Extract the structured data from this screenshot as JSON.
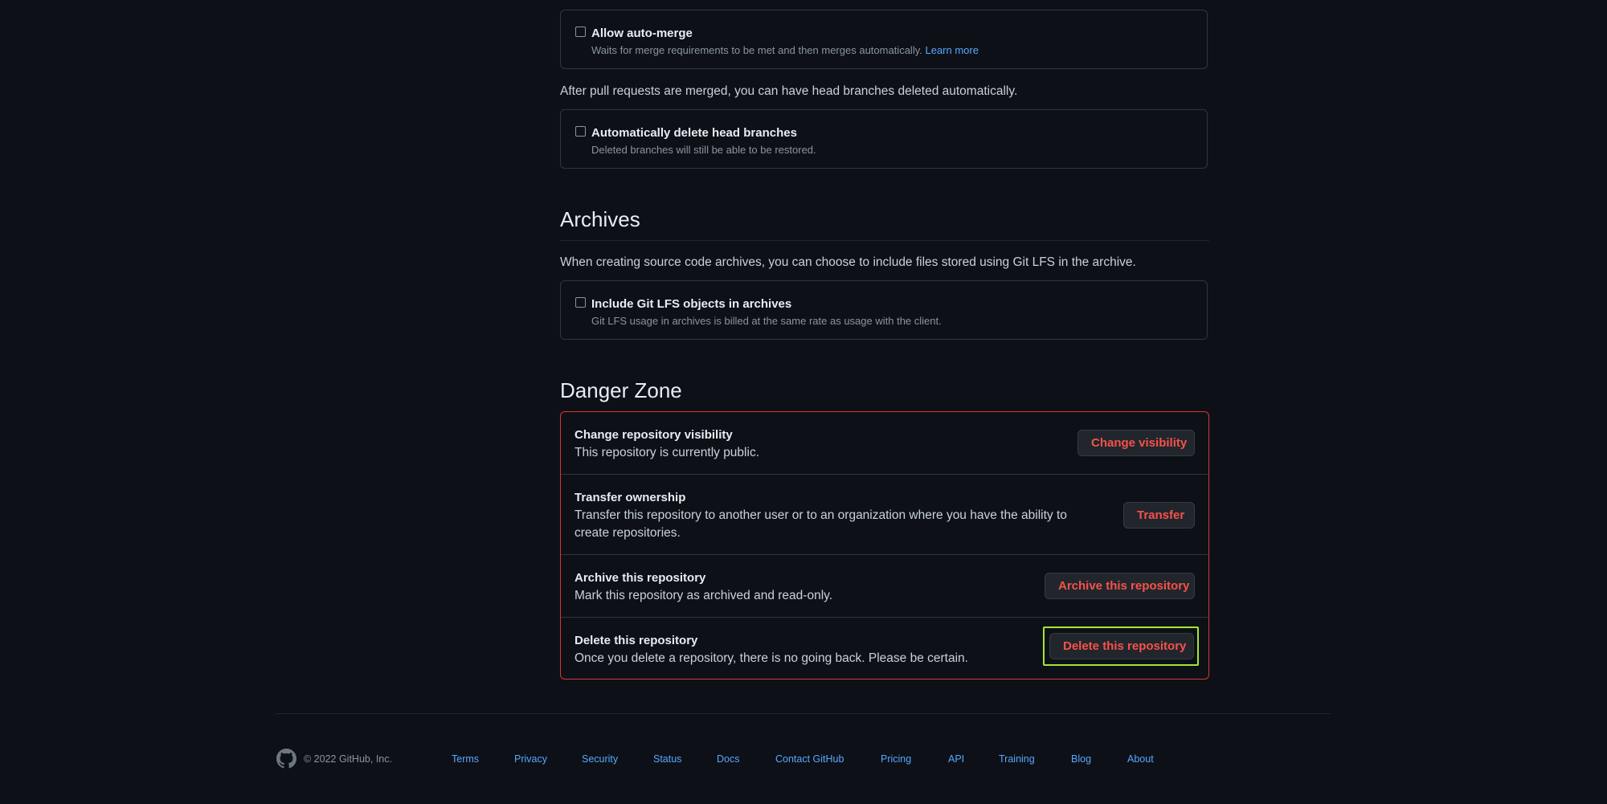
{
  "merge_options": {
    "auto_merge": {
      "title": "Allow auto-merge",
      "description": "Waits for merge requirements to be met and then merges automatically.",
      "link": "Learn more",
      "checked": false
    },
    "branches_intro": "After pull requests are merged, you can have head branches deleted automatically.",
    "delete_head_branches": {
      "title": "Automatically delete head branches",
      "description": "Deleted branches will still be able to be restored.",
      "checked": false
    }
  },
  "archives": {
    "heading": "Archives",
    "intro": "When creating source code archives, you can choose to include files stored using Git LFS in the archive.",
    "include_lfs": {
      "title": "Include Git LFS objects in archives",
      "description": "Git LFS usage in archives is billed at the same rate as usage with the client.",
      "checked": false
    }
  },
  "danger_zone": {
    "heading": "Danger Zone",
    "items": [
      {
        "title": "Change repository visibility",
        "description": "This repository is currently public.",
        "button": "Change visibility"
      },
      {
        "title": "Transfer ownership",
        "description": "Transfer this repository to another user or to an organization where you have the ability to create repositories.",
        "button": "Transfer"
      },
      {
        "title": "Archive this repository",
        "description": "Mark this repository as archived and read-only.",
        "button": "Archive this repository"
      },
      {
        "title": "Delete this repository",
        "description": "Once you delete a repository, there is no going back. Please be certain.",
        "button": "Delete this repository"
      }
    ]
  },
  "footer": {
    "logo_icon": "github-mark-icon",
    "copyright": "© 2022 GitHub, Inc.",
    "links": [
      "Terms",
      "Privacy",
      "Security",
      "Status",
      "Docs",
      "Contact GitHub",
      "Pricing",
      "API",
      "Training",
      "Blog",
      "About"
    ]
  },
  "colors": {
    "background": "#0d1117",
    "danger": "#f85149",
    "danger_border": "#da3633",
    "link": "#58a6ff",
    "focus_ring": "#a3e635"
  }
}
